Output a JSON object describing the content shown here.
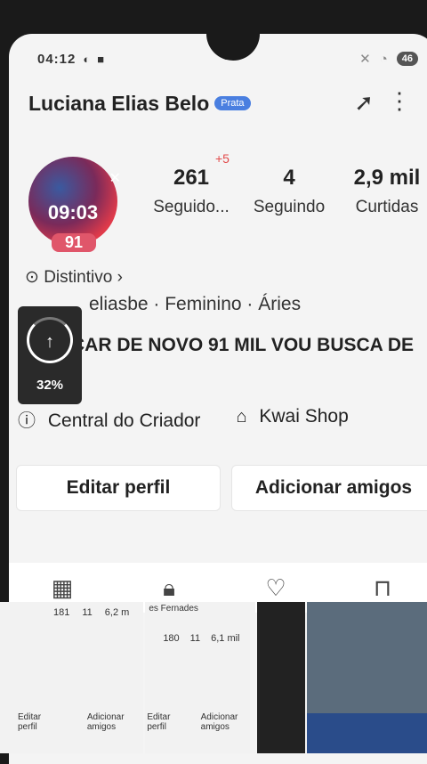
{
  "status_bar": {
    "time": "04:12",
    "battery": "46"
  },
  "profile": {
    "name": "Luciana Elias Belo",
    "badge": "Prata",
    "avatar_clock": "09:03",
    "avatar_score": "91",
    "plus_badge": "+5",
    "stats": [
      {
        "value": "261",
        "label": "Seguido..."
      },
      {
        "value": "4",
        "label": "Seguindo"
      },
      {
        "value": "2,9 mil",
        "label": "Curtidas"
      }
    ],
    "distintivo": "Distintivo",
    "info_line": "eliasbe · Feminino · Áries",
    "bio": "ÇAR DE NOVO 91 MIL VOU BUSCA DE"
  },
  "upload": {
    "percent": "32%"
  },
  "actions": [
    {
      "label": "Central do Criador"
    },
    {
      "label": "Kwai Shop"
    }
  ],
  "buttons": {
    "edit": "Editar perfil",
    "add_friends": "Adicionar amigos"
  },
  "grid": {
    "thumb1": {
      "stats": [
        "181",
        "11",
        "6,2 m"
      ],
      "edit": "Editar perfil",
      "add": "Adicionar amigos"
    },
    "thumb2": {
      "name": "es Fernades",
      "stats": [
        "180",
        "11",
        "6,1 mil"
      ],
      "edit": "Editar perfil",
      "add": "Adicionar amigos"
    }
  }
}
